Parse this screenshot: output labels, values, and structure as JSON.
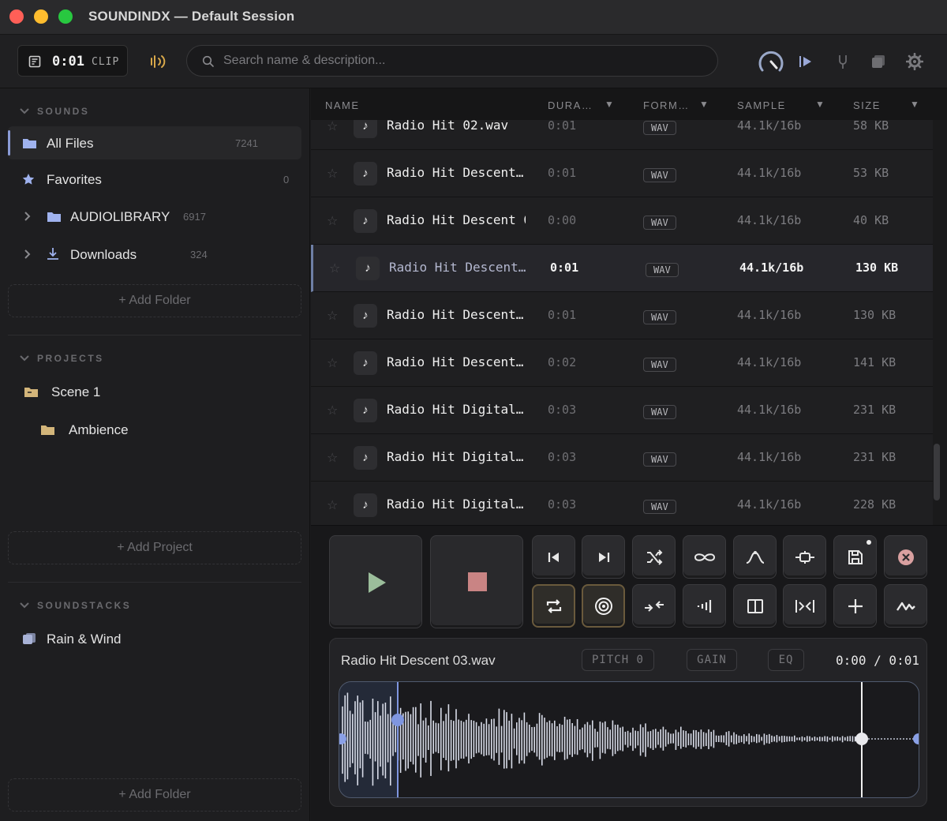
{
  "window": {
    "title": "SOUNDINDX — Default Session",
    "traffic_lights": [
      "#ff5f57",
      "#febc2e",
      "#28c840"
    ]
  },
  "toolbar": {
    "clip_time": "0:01",
    "clip_label": "CLIP",
    "search_placeholder": "Search name & description..."
  },
  "sidebar": {
    "sounds_header": "SOUNDS",
    "items": [
      {
        "label": "All Files",
        "count": "7241",
        "icon": "folder-icon"
      },
      {
        "label": "Favorites",
        "count": "0",
        "icon": "star-icon"
      },
      {
        "label": "AUDIOLIBRARY",
        "count": "6917",
        "icon": "folder-icon"
      },
      {
        "label": "Downloads",
        "count": "324",
        "icon": "download-icon"
      }
    ],
    "add_folder": "+ Add Folder",
    "projects_header": "PROJECTS",
    "projects": [
      {
        "label": "Scene 1",
        "icon": "open-folder-icon"
      },
      {
        "label": "Ambience",
        "icon": "folder-icon"
      }
    ],
    "add_project": "+ Add Project",
    "soundstacks_header": "SOUNDSTACKS",
    "soundstacks": [
      {
        "label": "Rain & Wind",
        "icon": "stack-icon"
      }
    ],
    "add_folder_bottom": "+ Add Folder"
  },
  "file_list": {
    "columns": [
      "NAME",
      "DURA…",
      "FORM…",
      "SAMPLE",
      "SIZE"
    ],
    "rows": [
      {
        "name": "Radio Hit 02.wav",
        "duration": "0:01",
        "format": "WAV",
        "sample": "44.1k/16b",
        "size": "58 KB"
      },
      {
        "name": "Radio Hit Descent…",
        "duration": "0:01",
        "format": "WAV",
        "sample": "44.1k/16b",
        "size": "53 KB"
      },
      {
        "name": "Radio Hit Descent 0",
        "duration": "0:00",
        "format": "WAV",
        "sample": "44.1k/16b",
        "size": "40 KB"
      },
      {
        "name": "Radio Hit Descent…",
        "duration": "0:01",
        "format": "WAV",
        "sample": "44.1k/16b",
        "size": "130 KB"
      },
      {
        "name": "Radio Hit Descent…",
        "duration": "0:01",
        "format": "WAV",
        "sample": "44.1k/16b",
        "size": "130 KB"
      },
      {
        "name": "Radio Hit Descent…",
        "duration": "0:02",
        "format": "WAV",
        "sample": "44.1k/16b",
        "size": "141 KB"
      },
      {
        "name": "Radio Hit Digital…",
        "duration": "0:03",
        "format": "WAV",
        "sample": "44.1k/16b",
        "size": "231 KB"
      },
      {
        "name": "Radio Hit Digital…",
        "duration": "0:03",
        "format": "WAV",
        "sample": "44.1k/16b",
        "size": "231 KB"
      },
      {
        "name": "Radio Hit Digital…",
        "duration": "0:03",
        "format": "WAV",
        "sample": "44.1k/16b",
        "size": "228 KB"
      }
    ],
    "selected_index": 3
  },
  "player": {
    "file_name": "Radio Hit Descent 03.wav",
    "pitch": "PITCH 0",
    "gain": "GAIN",
    "eq": "EQ",
    "time": "0:00 / 0:01",
    "playhead_fraction": 0.1,
    "end_marker_fraction": 0.9
  },
  "colors": {
    "accent": "#6e7fa6",
    "waveform": "#d8dce8",
    "active_border": "#6a5a3c",
    "stop": "#c97a7a"
  }
}
